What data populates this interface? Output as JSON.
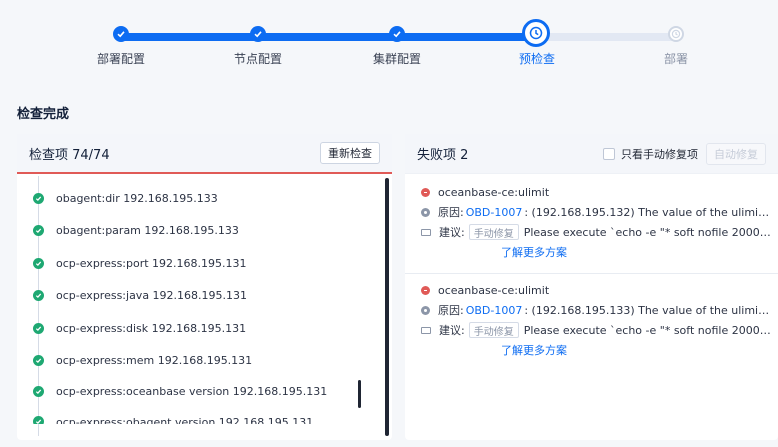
{
  "steps": [
    {
      "label": "部署配置",
      "state": "done"
    },
    {
      "label": "节点配置",
      "state": "done"
    },
    {
      "label": "集群配置",
      "state": "done"
    },
    {
      "label": "预检查",
      "state": "current"
    },
    {
      "label": "部署",
      "state": "future"
    }
  ],
  "section_title": "检查完成",
  "left_panel": {
    "title": "检查项 74/74",
    "recheck_button": "重新检查",
    "items": [
      "obagent:dir 192.168.195.133",
      "obagent:param 192.168.195.133",
      "ocp-express:port 192.168.195.131",
      "ocp-express:java 192.168.195.131",
      "ocp-express:disk 192.168.195.131",
      "ocp-express:mem 192.168.195.131",
      "ocp-express:oceanbase version 192.168.195.131",
      "ocp-express:obagent version 192.168.195.131"
    ]
  },
  "right_panel": {
    "title": "失败项 2",
    "manual_only_label": "只看手动修复项",
    "auto_fix_button": "自动修复",
    "failures": [
      {
        "name": "oceanbase-ce:ulimit",
        "reason_label": "原因:",
        "reason_code": "OBD-1007",
        "reason_text": ": (192.168.195.132) The value of the ulimit par...",
        "advice_label": "建议:",
        "advice_tag": "手动修复",
        "advice_text": "Please execute `echo -e \"* soft nofile 20000\\n* ...",
        "more_link": "了解更多方案"
      },
      {
        "name": "oceanbase-ce:ulimit",
        "reason_label": "原因:",
        "reason_code": "OBD-1007",
        "reason_text": ": (192.168.195.133) The value of the ulimit par...",
        "advice_label": "建议:",
        "advice_tag": "手动修复",
        "advice_text": "Please execute `echo -e \"* soft nofile 20000\\n* ...",
        "more_link": "了解更多方案"
      }
    ]
  },
  "colors": {
    "primary": "#0d6cf2",
    "success": "#1ea872",
    "error": "#e05a57"
  }
}
